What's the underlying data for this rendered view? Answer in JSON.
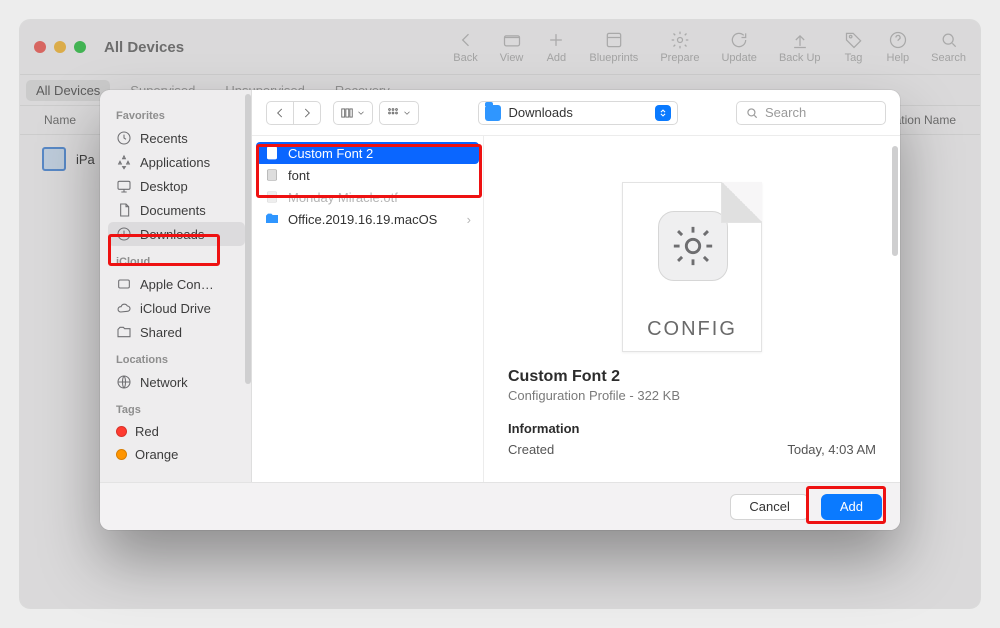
{
  "bg": {
    "title": "All Devices",
    "actions": [
      {
        "name": "back",
        "label": "Back"
      },
      {
        "name": "view",
        "label": "View"
      },
      {
        "name": "add",
        "label": "Add"
      },
      {
        "name": "blueprints",
        "label": "Blueprints"
      },
      {
        "name": "prepare",
        "label": "Prepare"
      },
      {
        "name": "update",
        "label": "Update"
      },
      {
        "name": "backup",
        "label": "Back Up"
      },
      {
        "name": "tag",
        "label": "Tag"
      },
      {
        "name": "help",
        "label": "Help"
      },
      {
        "name": "search",
        "label": "Search"
      }
    ],
    "filters": [
      {
        "label": "All Devices",
        "active": true
      },
      {
        "label": "Supervised",
        "active": false
      },
      {
        "label": "Unsupervised",
        "active": false
      },
      {
        "label": "Recovery",
        "active": false
      }
    ],
    "columns": {
      "left": "Name",
      "right": "...nization Name"
    },
    "row_label": "iPa"
  },
  "picker": {
    "favorites_header": "Favorites",
    "icloud_header": "iCloud",
    "locations_header": "Locations",
    "tags_header": "Tags",
    "favorites": [
      {
        "id": "recents",
        "label": "Recents",
        "icon": "clock"
      },
      {
        "id": "applications",
        "label": "Applications",
        "icon": "apps"
      },
      {
        "id": "desktop",
        "label": "Desktop",
        "icon": "desktop"
      },
      {
        "id": "documents",
        "label": "Documents",
        "icon": "doc"
      },
      {
        "id": "downloads",
        "label": "Downloads",
        "icon": "download",
        "selected": true
      }
    ],
    "icloud": [
      {
        "id": "applecon",
        "label": "Apple Con…",
        "icon": "box"
      },
      {
        "id": "iclouddrive",
        "label": "iCloud Drive",
        "icon": "cloud"
      },
      {
        "id": "shared",
        "label": "Shared",
        "icon": "folder-shared"
      }
    ],
    "locations": [
      {
        "id": "network",
        "label": "Network",
        "icon": "globe"
      }
    ],
    "tags": [
      {
        "id": "red",
        "label": "Red",
        "color": "#ff3b30"
      },
      {
        "id": "orange",
        "label": "Orange",
        "color": "#ff9500"
      }
    ],
    "location_popup": "Downloads",
    "search_placeholder": "Search",
    "files": [
      {
        "name": "Custom Font 2",
        "icon": "config",
        "selected": true
      },
      {
        "name": "font",
        "icon": "zip"
      },
      {
        "name": "Monday Miracle.otf",
        "icon": "font"
      },
      {
        "name": "Office.2019.16.19.macOS",
        "icon": "folder",
        "children": true
      }
    ],
    "preview": {
      "badge": "CONFIG",
      "title": "Custom Font 2",
      "subtitle": "Configuration Profile - 322 KB",
      "info_header": "Information",
      "created_label": "Created",
      "created_value": "Today, 4:03 AM"
    },
    "buttons": {
      "cancel": "Cancel",
      "add": "Add"
    }
  }
}
